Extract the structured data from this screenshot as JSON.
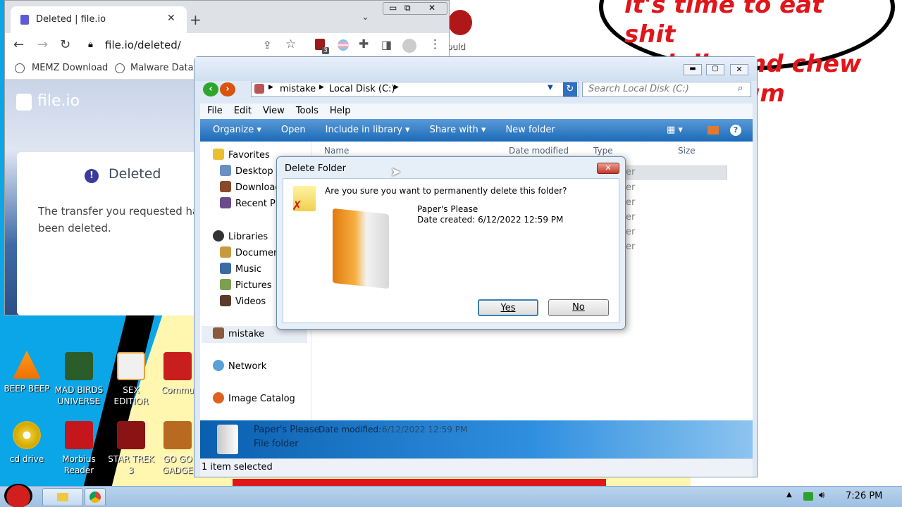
{
  "bubble": {
    "lines": [
      "it's time to eat shit",
      "and die and chew",
      "bubble gum"
    ]
  },
  "desktop_icons": [
    {
      "label": "BEEP BEEP"
    },
    {
      "label": "MAD BIRDS UNIVERSE"
    },
    {
      "label": "SEX EDITIOR"
    },
    {
      "label": "Commu"
    },
    {
      "label": "cd drive"
    },
    {
      "label": "Morbius Reader"
    },
    {
      "label": "STAR TREK 3"
    },
    {
      "label": "GO GO GADGE"
    },
    {
      "label": "ould"
    }
  ],
  "chrome": {
    "tab_title": "Deleted | file.io",
    "url": "file.io/deleted/",
    "bookmarks": [
      "MEMZ Download",
      "Malware Databa"
    ],
    "extension_badge": "3",
    "logo_text": "file.io",
    "card_title": "Deleted",
    "card_body": "The transfer you requested has been deleted."
  },
  "explorer": {
    "breadcrumb": [
      "mistake",
      "Local Disk (C:)"
    ],
    "search_placeholder": "Search Local Disk (C:)",
    "menu": [
      "File",
      "Edit",
      "View",
      "Tools",
      "Help"
    ],
    "commands": [
      "Organize ▾",
      "Open",
      "Include in library ▾",
      "Share with ▾",
      "New folder"
    ],
    "columns": [
      "Name",
      "Date modified",
      "Type",
      "Size"
    ],
    "nav": {
      "favorites": "Favorites",
      "favorite_items": [
        "Desktop",
        "Downloads",
        "Recent Places"
      ],
      "libraries": "Libraries",
      "library_items": [
        "Documents",
        "Music",
        "Pictures",
        "Videos"
      ],
      "mistake": "mistake",
      "network": "Network",
      "image_catalog": "Image Catalog"
    },
    "type_fragments": [
      "er",
      "er",
      "er",
      "er",
      "er",
      "er"
    ],
    "details": {
      "name": "Paper's Please",
      "date_label": "Date modified:",
      "date_value": "6/12/2022 12:59 PM",
      "kind": "File folder"
    },
    "status": "1 item selected"
  },
  "dialog": {
    "title": "Delete Folder",
    "question": "Are you sure you want to permanently delete this folder?",
    "folder_name": "Paper's Please",
    "created": "Date created: 6/12/2022 12:59 PM",
    "yes": "Yes",
    "no": "No"
  },
  "taskbar": {
    "time": "7:26 PM"
  },
  "colors": {
    "explorer_cmdbar": "#1b6ab8",
    "bubble_text": "#e0161b",
    "details_pane": "#0b5fb0"
  }
}
